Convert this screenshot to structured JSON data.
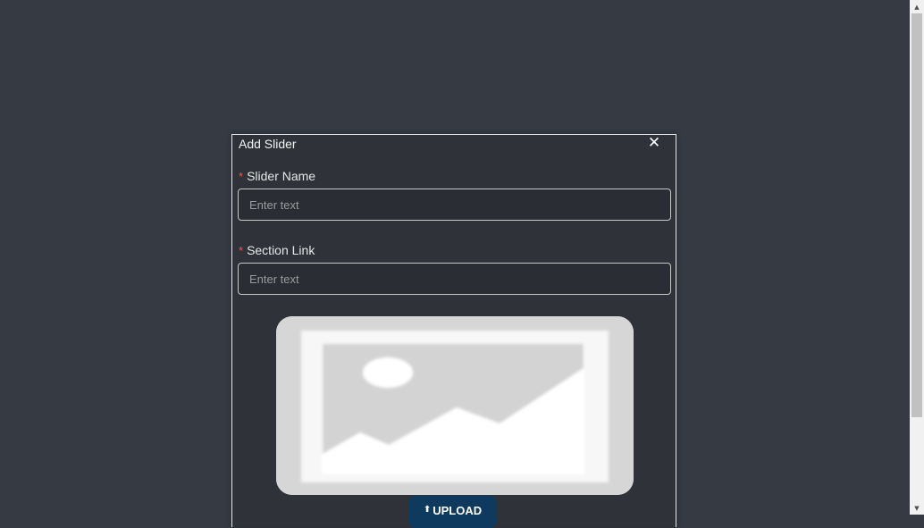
{
  "modal": {
    "title": "Add Slider",
    "close_icon": "close-icon",
    "fields": {
      "slider_name": {
        "required_mark": "*",
        "label": "Slider Name",
        "value": "",
        "placeholder": "Enter text"
      },
      "section_link": {
        "required_mark": "*",
        "label": "Section Link",
        "value": "",
        "placeholder": "Enter text"
      }
    },
    "image_placeholder_icon": "image-placeholder-icon",
    "upload": {
      "icon": "upload-arrow-icon",
      "label": "UPLOAD"
    }
  },
  "colors": {
    "backdrop": "#363b43",
    "modal_bg": "#2f3339",
    "required": "#ff4d4f",
    "upload_button": "#0e3a5f"
  }
}
